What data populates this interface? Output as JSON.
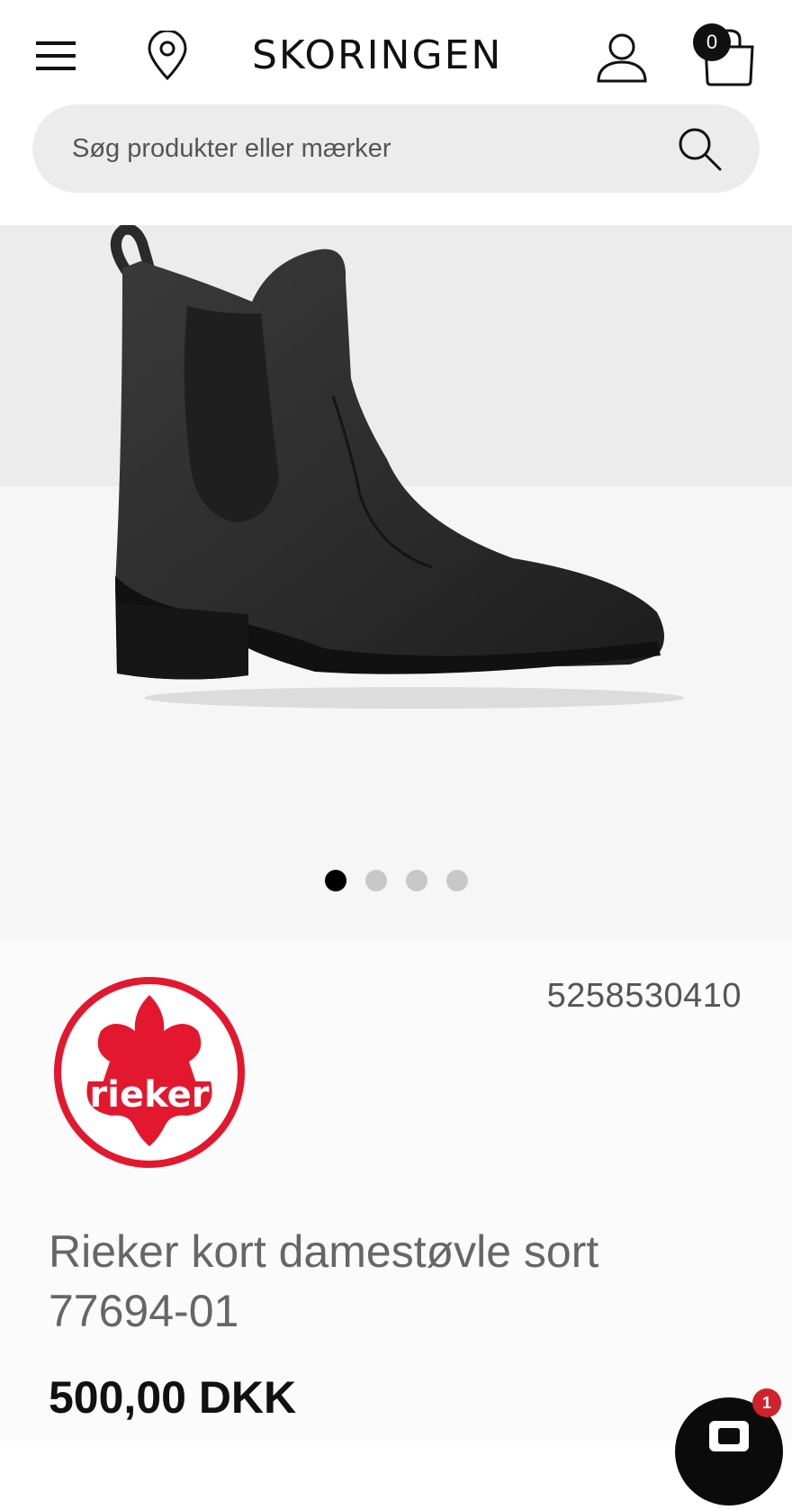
{
  "header": {
    "logo_text": "SKORINGEN",
    "cart_count": "0",
    "icons": [
      "menu-icon",
      "location-pin-icon",
      "user-icon",
      "shopping-bag-icon"
    ]
  },
  "search": {
    "placeholder": "Søg produkter eller mærker",
    "icon": "search-icon"
  },
  "gallery": {
    "image": "black chelsea ankle boot",
    "slide_count": 4,
    "active_slide": 1
  },
  "product": {
    "brand": "rieker",
    "brand_color": "#e3172d",
    "sku": "5258530410",
    "title": "Rieker kort damestøvle sort 77694-01",
    "price": "500,00 DKK"
  },
  "chat": {
    "badge_count": "1",
    "icon": "chat-icon"
  }
}
